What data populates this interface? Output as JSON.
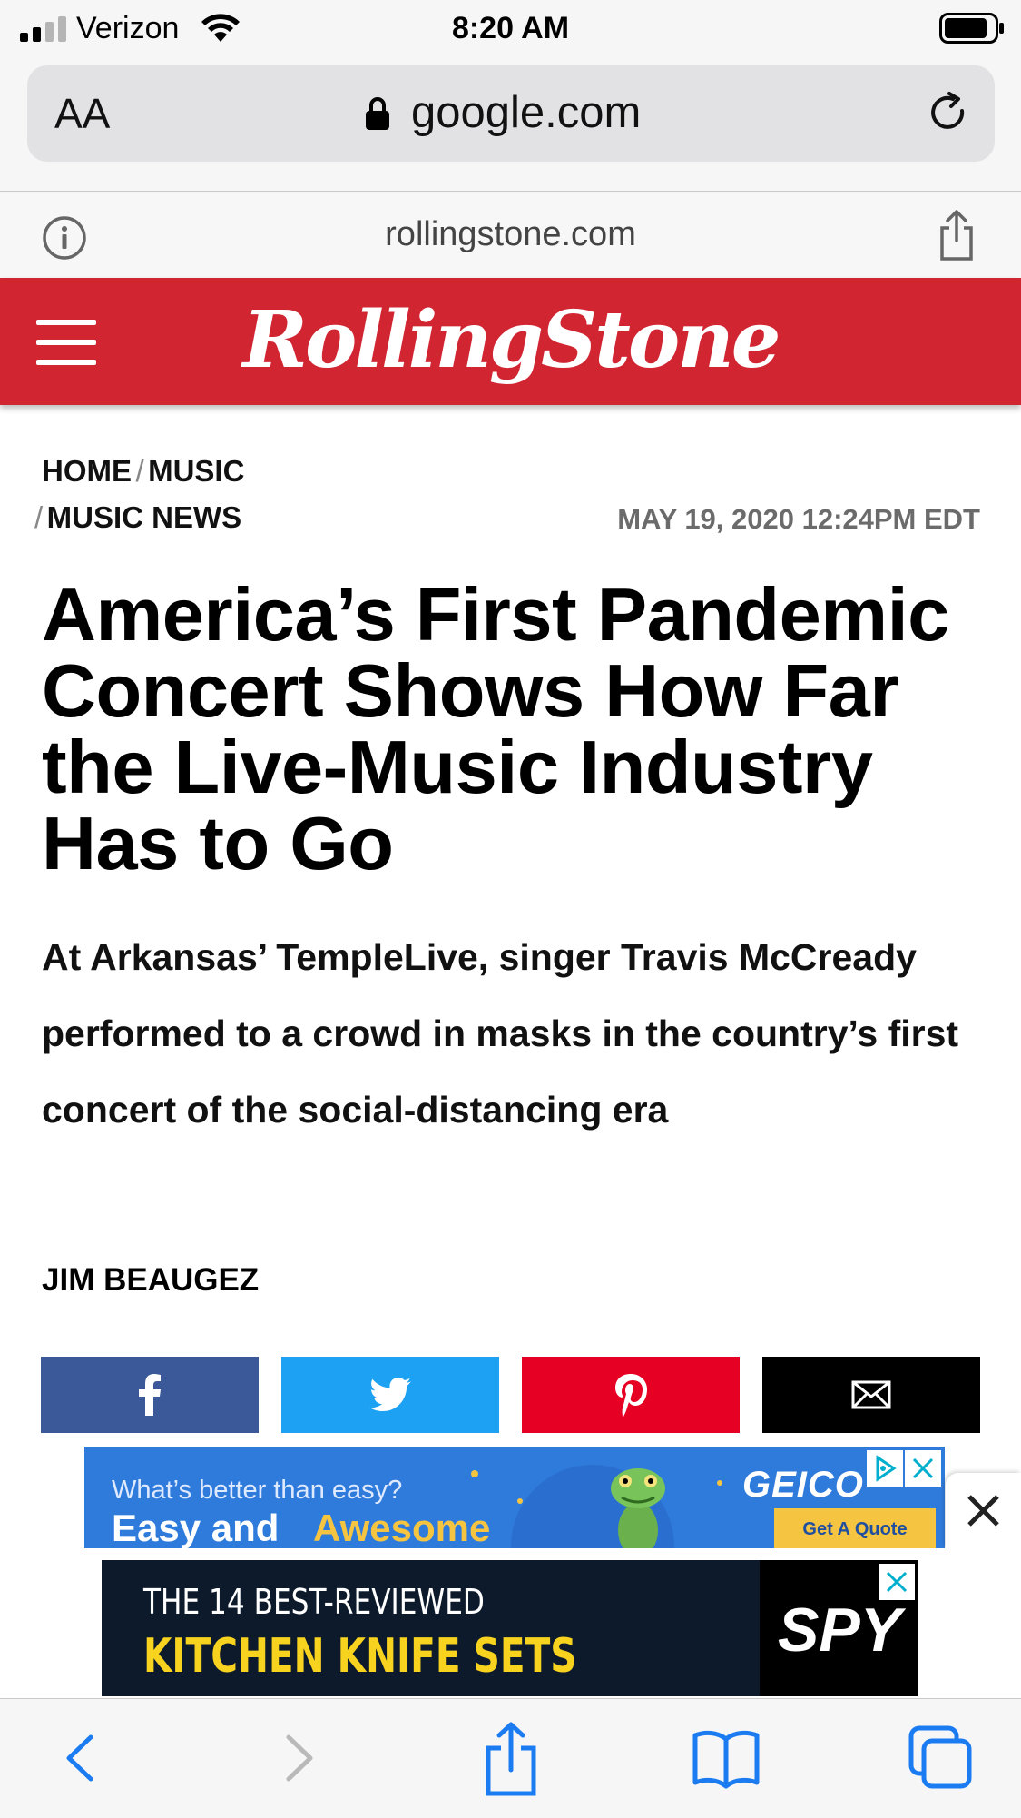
{
  "status_bar": {
    "carrier": "Verizon",
    "time": "8:20 AM"
  },
  "url_bar": {
    "text_size_label": "AA",
    "domain": "google.com"
  },
  "origin_bar": {
    "domain": "rollingstone.com"
  },
  "site_header": {
    "logo_text": "RollingStone"
  },
  "breadcrumb": {
    "home": "HOME",
    "section": "MUSIC",
    "subsection": "MUSIC NEWS",
    "separator": "/"
  },
  "article": {
    "date": "MAY 19, 2020 12:24PM EDT",
    "headline": "America’s First Pandemic Concert Shows How Far the Live-Music Industry Has to Go",
    "dek": "At Arkansas’ TempleLive, singer Travis McCready performed to a crowd in masks in the country’s first concert of the social-distancing era",
    "byline": "JIM BEAUGEZ"
  },
  "share": {
    "facebook_color": "#3b5998",
    "twitter_color": "#1da1f2",
    "pinterest_color": "#e60023",
    "email_color": "#000000"
  },
  "ad_geico": {
    "question": "What’s better than easy?",
    "headline_a": "Easy and",
    "headline_b": "Awesome",
    "brand": "GEICO",
    "cta": "Get A Quote"
  },
  "ad_spy": {
    "line1": "THE 14 BEST-REVIEWED",
    "line2": "KITCHEN KNIFE SETS",
    "brand": "SPY"
  },
  "colors": {
    "brand_red": "#d12532",
    "ios_blue": "#1b7cf2"
  }
}
